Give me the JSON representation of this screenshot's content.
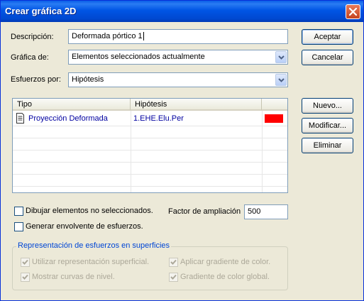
{
  "window": {
    "title": "Crear gráfica 2D"
  },
  "form": {
    "descripcion_label": "Descripción:",
    "descripcion_value": "Deformada pórtico 1",
    "grafica_label": "Gráfica de:",
    "grafica_value": "Elementos seleccionados actualmente",
    "esfuerzos_label": "Esfuerzos por:",
    "esfuerzos_value": "Hipótesis"
  },
  "buttons": {
    "aceptar": "Aceptar",
    "cancelar": "Cancelar",
    "nuevo": "Nuevo...",
    "modificar": "Modificar...",
    "eliminar": "Eliminar"
  },
  "list": {
    "columns": [
      "Tipo",
      "Hipótesis",
      ""
    ],
    "rows": [
      {
        "tipo": "Proyección Deformada",
        "hipotesis": "1.EHE.Elu.Per",
        "color": "#ff0000"
      }
    ]
  },
  "options": {
    "dibujar_label": "Dibujar elementos no seleccionados.",
    "dibujar_checked": false,
    "generar_label": "Generar envolvente de esfuerzos.",
    "generar_checked": false,
    "factor_label": "Factor de ampliación",
    "factor_value": "500"
  },
  "superficies": {
    "title": "Representación de esfuerzos en superficies",
    "utilizar_label": "Utilizar representación superficial.",
    "mostrar_label": "Mostrar curvas de nivel.",
    "aplicar_label": "Aplicar gradiente de color.",
    "gradiente_label": "Gradiente de color global.",
    "all_checked_disabled": true
  }
}
